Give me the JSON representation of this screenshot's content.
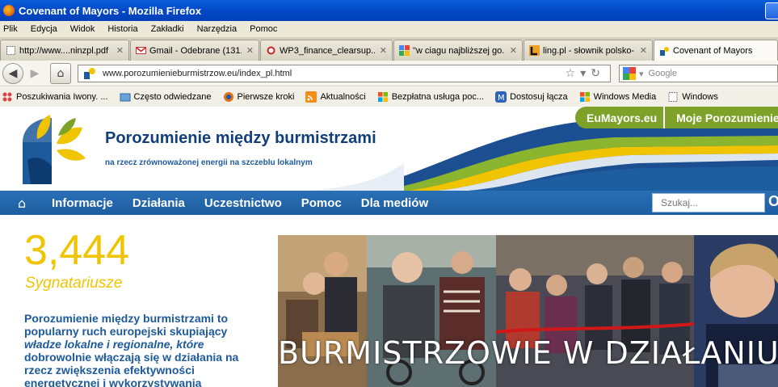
{
  "window": {
    "title": "Covenant of Mayors - Mozilla Firefox"
  },
  "menu": [
    "Plik",
    "Edycja",
    "Widok",
    "Historia",
    "Zakładki",
    "Narzędzia",
    "Pomoc"
  ],
  "tabs": [
    {
      "label": "http://www....ninzpl.pdf",
      "icon": "page-icon"
    },
    {
      "label": "Gmail - Odebrane (131...",
      "icon": "gmail-icon"
    },
    {
      "label": "WP3_finance_clearsup...",
      "icon": "pdf-icon"
    },
    {
      "label": "\"w ciagu najbliższej go...",
      "icon": "google-icon"
    },
    {
      "label": "ling.pl - słownik polsko-...",
      "icon": "ling-icon"
    },
    {
      "label": "Covenant of Mayors",
      "icon": "covenant-icon",
      "active": true
    }
  ],
  "nav": {
    "url": "www.porozumienieburmistrzow.eu/index_pl.html",
    "search_placeholder": "Google"
  },
  "bookmarks": [
    {
      "label": "Poszukiwania Iwony. ...",
      "icon": "bookmark-icon"
    },
    {
      "label": "Często odwiedzane",
      "icon": "folder-icon"
    },
    {
      "label": "Pierwsze kroki",
      "icon": "firefox-icon"
    },
    {
      "label": "Aktualności",
      "icon": "rss-icon"
    },
    {
      "label": "Bezpłatna usługa poc...",
      "icon": "windows-icon"
    },
    {
      "label": "Dostosuj łącza",
      "icon": "msn-icon"
    },
    {
      "label": "Windows Media",
      "icon": "windows-icon"
    },
    {
      "label": "Windows",
      "icon": "page-icon"
    }
  ],
  "site": {
    "title": "Porozumienie między burmistrzami",
    "subtitle": "na rzecz zrównoważonej energii na szczeblu lokalnym",
    "top_links": [
      "EuMayors.eu",
      "Moje Porozumienie"
    ],
    "main_nav": [
      "Informacje",
      "Działania",
      "Uczestnictwo",
      "Pomoc",
      "Dla mediów"
    ],
    "search_placeholder": "Szukaj...",
    "search_button": "O",
    "counter": {
      "value": "3,444",
      "label": "Sygnatariusze"
    },
    "intro": {
      "part1": "Porozumienie między burmistrzami to popularny ruch europejski skupiający",
      "italic": "władze lokalne i regionalne, które",
      "part2": "dobrowolnie włączają się w działania na rzecz zwiększenia efektywności energetycznej i wykorzystywania"
    },
    "banner_text": "BURMISTRZOWIE W DZIAŁANIU"
  },
  "colors": {
    "xp_titlebar": "#0449c7",
    "brand_blue": "#123f7a",
    "nav_blue": "#1d5ea0",
    "green": "#7ea12a",
    "yellow": "#f0c400"
  }
}
